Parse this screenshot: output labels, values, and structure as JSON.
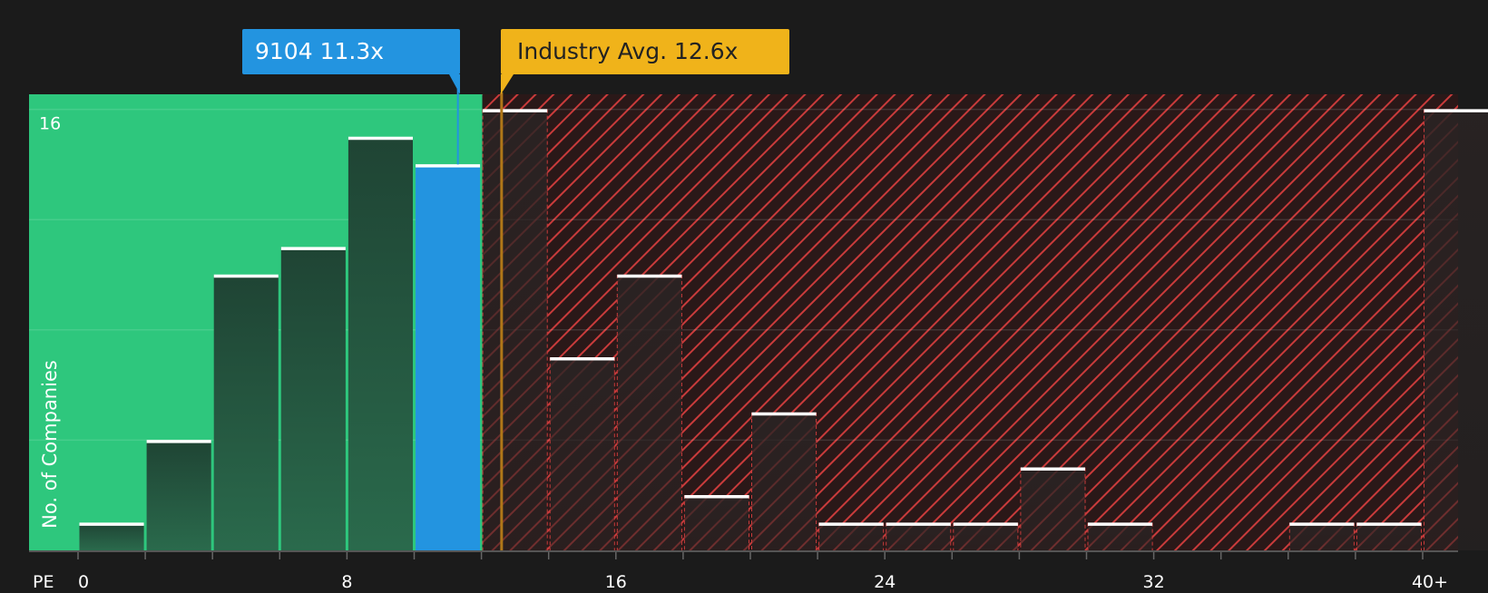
{
  "chart_data": {
    "type": "bar",
    "xlabel": "PE",
    "ylabel": "No. of Companies",
    "x_ticks": [
      "0",
      "8",
      "16",
      "24",
      "32",
      "40+"
    ],
    "y_tick_labels": [
      "16"
    ],
    "ylim": [
      0,
      16.5
    ],
    "bin_width": 2,
    "grid": true,
    "bars": [
      {
        "start": 0,
        "value": 1,
        "zone": "undervalued"
      },
      {
        "start": 2,
        "value": 4,
        "zone": "undervalued"
      },
      {
        "start": 4,
        "value": 10,
        "zone": "undervalued"
      },
      {
        "start": 6,
        "value": 11,
        "zone": "undervalued"
      },
      {
        "start": 8,
        "value": 15,
        "zone": "undervalued"
      },
      {
        "start": 10,
        "value": 14,
        "zone": "highlight"
      },
      {
        "start": 12,
        "value": 16,
        "zone": "overvalued"
      },
      {
        "start": 14,
        "value": 7,
        "zone": "overvalued"
      },
      {
        "start": 16,
        "value": 10,
        "zone": "overvalued"
      },
      {
        "start": 18,
        "value": 2,
        "zone": "overvalued"
      },
      {
        "start": 20,
        "value": 5,
        "zone": "overvalued"
      },
      {
        "start": 22,
        "value": 1,
        "zone": "overvalued"
      },
      {
        "start": 24,
        "value": 1,
        "zone": "overvalued"
      },
      {
        "start": 26,
        "value": 1,
        "zone": "overvalued"
      },
      {
        "start": 28,
        "value": 3,
        "zone": "overvalued"
      },
      {
        "start": 30,
        "value": 1,
        "zone": "overvalued"
      },
      {
        "start": 32,
        "value": 0,
        "zone": "overvalued"
      },
      {
        "start": 34,
        "value": 0,
        "zone": "overvalued"
      },
      {
        "start": 36,
        "value": 1,
        "zone": "overvalued"
      },
      {
        "start": 38,
        "value": 1,
        "zone": "overvalued"
      },
      {
        "start": 40,
        "value": 16,
        "zone": "overvalued"
      }
    ],
    "company": {
      "label": "9104 11.3x",
      "pe": 11.3
    },
    "industry_avg": {
      "label": "Industry Avg. 12.6x",
      "pe": 12.6
    },
    "colors": {
      "background": "#1b1b1b",
      "undervalued_zone": "#2ec77d",
      "overvalued_zone": "#b83232",
      "bar_dark": "#1f3a2e",
      "highlight": "#2394e0",
      "industry": "#f0b31a",
      "label_text": "#ffffff",
      "industry_label_text": "#222222"
    }
  }
}
